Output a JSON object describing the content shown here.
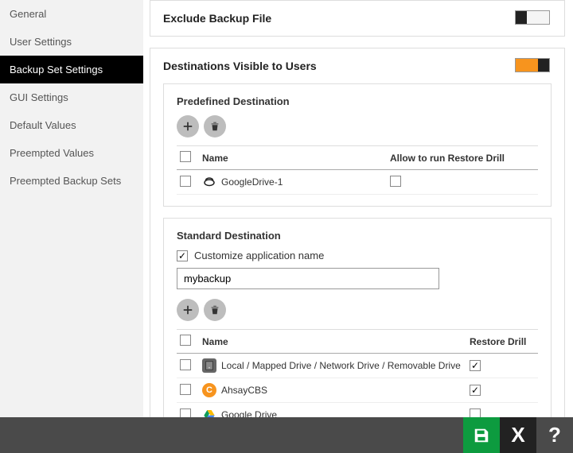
{
  "sidebar": {
    "items": [
      {
        "label": "General",
        "active": false
      },
      {
        "label": "User Settings",
        "active": false
      },
      {
        "label": "Backup Set Settings",
        "active": true
      },
      {
        "label": "GUI Settings",
        "active": false
      },
      {
        "label": "Default Values",
        "active": false
      },
      {
        "label": "Preempted Values",
        "active": false
      },
      {
        "label": "Preempted Backup Sets",
        "active": false
      }
    ]
  },
  "exclude_panel": {
    "title": "Exclude Backup File",
    "enabled": false
  },
  "dest_panel": {
    "title": "Destinations Visible to Users",
    "enabled": true,
    "predefined": {
      "title": "Predefined Destination",
      "cols": {
        "name": "Name",
        "restore": "Allow to run Restore Drill"
      },
      "rows": [
        {
          "name": "GoogleDrive-1",
          "icon": "cloud-drive",
          "selected": false,
          "restore": false
        }
      ]
    },
    "standard": {
      "title": "Standard Destination",
      "customize_label": "Customize application name",
      "customize_checked": true,
      "app_name": "mybackup",
      "cols": {
        "name": "Name",
        "restore": "Restore Drill"
      },
      "rows": [
        {
          "name": "Local / Mapped Drive / Network Drive / Removable Drive",
          "icon": "local-drive",
          "selected": false,
          "restore": true
        },
        {
          "name": "AhsayCBS",
          "icon": "ahsay",
          "selected": false,
          "restore": true
        },
        {
          "name": "Google Drive",
          "icon": "gdrive",
          "selected": false,
          "restore": false
        }
      ]
    }
  },
  "footer": {
    "save": "save",
    "close": "X",
    "help": "?"
  }
}
